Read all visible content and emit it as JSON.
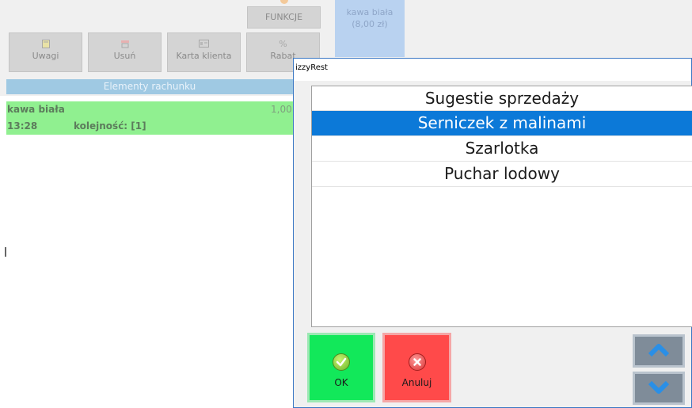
{
  "background": {
    "functions_label": "FUNKCJE",
    "product_tile": {
      "name": "kawa biała",
      "price": "(8,00 zł)"
    },
    "toolbar": [
      {
        "label": "Uwagi",
        "icon": "note-icon"
      },
      {
        "label": "Usuń",
        "icon": "delete-icon"
      },
      {
        "label": "Karta klienta",
        "icon": "client-card-icon"
      },
      {
        "label": "Rabat",
        "icon": "percent-icon",
        "icon_text": "%"
      }
    ],
    "elements_header": "Elementy rachunku",
    "order_item": {
      "name": "kawa biała",
      "quantity": "1,00",
      "time": "13:28",
      "sequence": "kolejność: [1]"
    }
  },
  "dialog": {
    "title": "izzyRest",
    "list_header": "Sugestie sprzedaży",
    "items": [
      {
        "label": "Serniczek z malinami",
        "selected": true
      },
      {
        "label": "Szarlotka",
        "selected": false
      },
      {
        "label": "Puchar lodowy",
        "selected": false
      }
    ],
    "ok_label": "OK",
    "cancel_label": "Anuluj"
  },
  "colors": {
    "selection": "#0c79d8",
    "ok_green": "#12e85a",
    "cancel_red": "#ff4a4a",
    "order_green": "#90f090",
    "header_blue": "#9fc9e3"
  }
}
